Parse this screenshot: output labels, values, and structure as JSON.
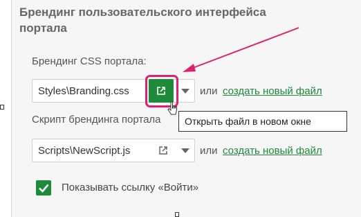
{
  "header": {
    "title": "Брендинг пользовательского интерфейса портала"
  },
  "css_branding": {
    "label": "Брендинг CSS портала:",
    "value": "Styles\\Branding.css",
    "or_text": "или",
    "create_link": "создать новый файл",
    "open_button_icon": "external-link-icon",
    "tooltip": "Открыть файл в новом окне"
  },
  "script_branding": {
    "label": "Скрипт брендинга портала",
    "value": "Scripts\\NewScript.js",
    "or_text": "или",
    "create_link": "создать новый файл",
    "open_button_icon": "external-link-icon"
  },
  "login_link": {
    "checked": true,
    "label": "Показывать ссылку «Войти»"
  },
  "colors": {
    "accent": "#1f8a3a",
    "highlight": "#e0206c"
  }
}
